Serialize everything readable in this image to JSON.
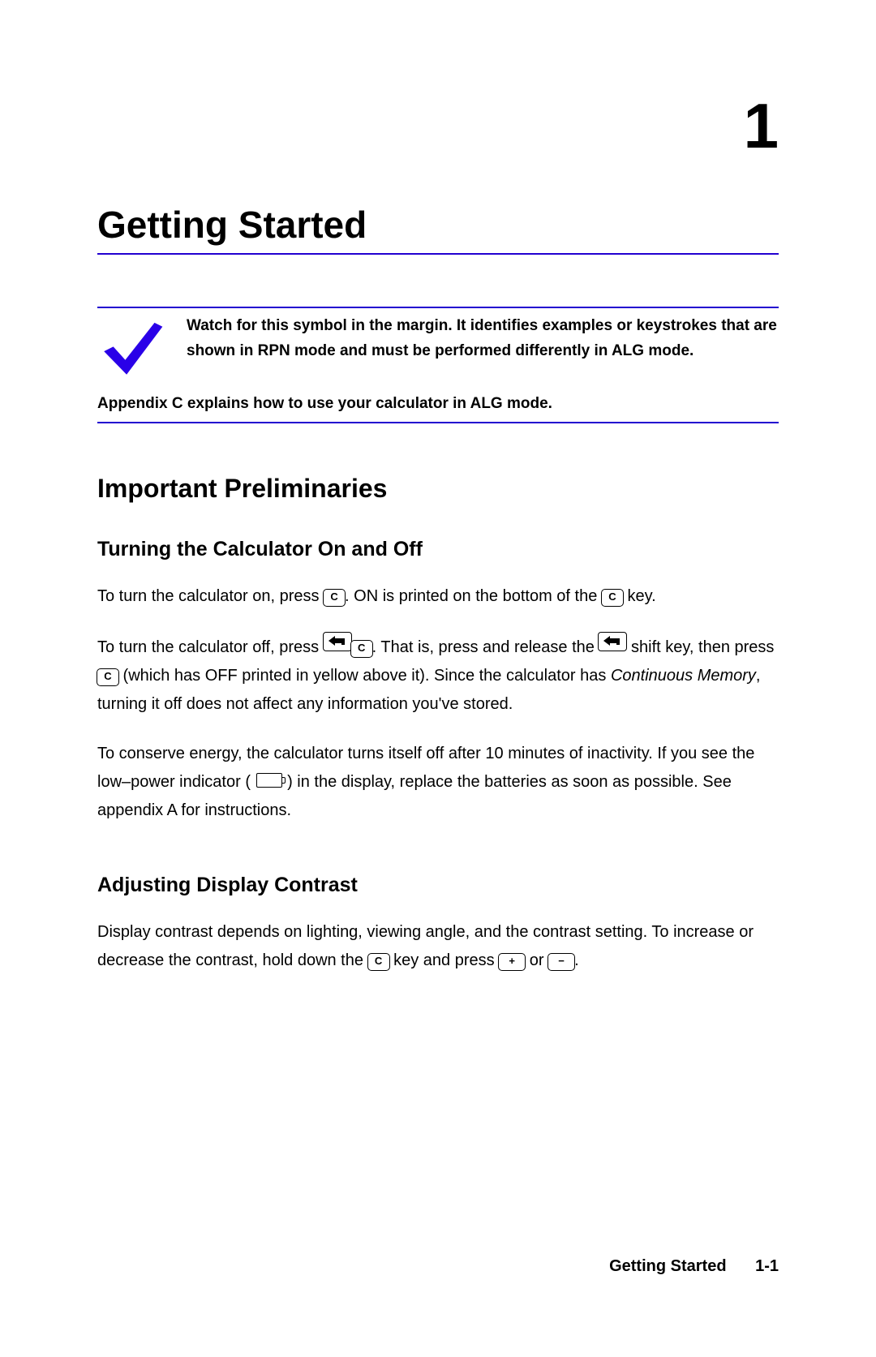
{
  "chapter": {
    "number": "1",
    "title": "Getting Started"
  },
  "callout": {
    "line1": "Watch for this symbol in the margin. It identifies examples or keystrokes that are shown in RPN mode and must be performed differently in ALG mode.",
    "line2": "Appendix C explains how to use your calculator in ALG mode."
  },
  "sections": {
    "prelim_heading": "Important Preliminaries",
    "onoff_heading": "Turning the Calculator On and Off",
    "contrast_heading": "Adjusting Display Contrast"
  },
  "keys": {
    "c": "C",
    "plus": "+",
    "minus": "−"
  },
  "body": {
    "on_1": "To turn the calculator on, press ",
    "on_2": ". ON is printed on the bottom of the ",
    "on_3": " key.",
    "off_1": "To turn the calculator off, press ",
    "off_2": ". That is, press and release the ",
    "off_3": " shift key, then press ",
    "off_4": " (which has OFF printed in yellow above it). Since the calculator has ",
    "off_italic": "Continuous Memory",
    "off_5": ", turning it off does not affect any information you've stored.",
    "conserve_1": "To conserve energy, the calculator turns itself off after 10 minutes of inactivity. If you see the low–power indicator ( ",
    "conserve_2": " ) in the display, replace the batteries as soon as possible. See appendix A for instructions.",
    "contrast_1": "Display contrast depends on lighting, viewing angle, and the contrast setting. To increase or decrease the contrast, hold down the ",
    "contrast_2": " key and press ",
    "contrast_or": " or ",
    "contrast_3": "."
  },
  "footer": {
    "title": "Getting Started",
    "page": "1-1"
  }
}
